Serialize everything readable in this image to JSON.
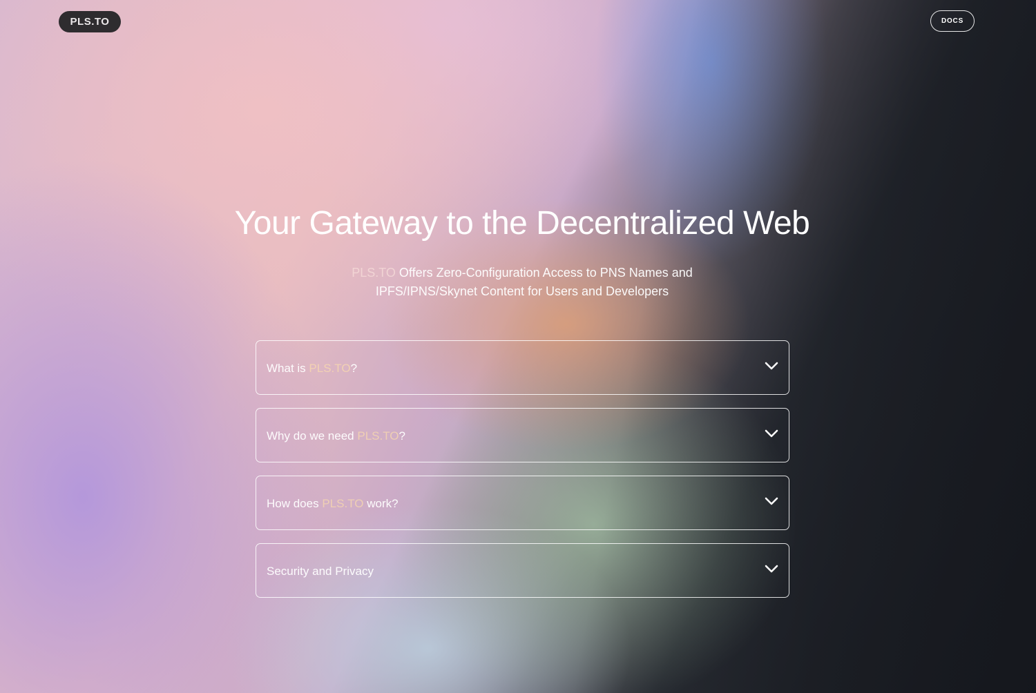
{
  "header": {
    "logo": "PLS.TO",
    "docs_label": "DOCS"
  },
  "hero": {
    "title": "Your Gateway to the Decentralized Web",
    "subtitle_brand": "PLS.TO",
    "subtitle_line1_rest": "Offers Zero-Configuration Access to PNS Names and",
    "subtitle_line2": "IPFS/IPNS/Skynet Content for Users and Developers"
  },
  "faq": [
    {
      "prefix": "What is",
      "brand": "PLS.TO",
      "suffix": "?",
      "icon": "chevron-down-icon"
    },
    {
      "prefix": "Why do we need",
      "brand": "PLS.TO",
      "suffix": "?",
      "icon": "chevron-down-icon"
    },
    {
      "prefix": "How does",
      "brand": "PLS.TO",
      "suffix": "work?",
      "icon": "chevron-down-icon"
    },
    {
      "prefix": "Security and Privacy",
      "brand": "",
      "suffix": "",
      "icon": "chevron-down-icon"
    }
  ]
}
